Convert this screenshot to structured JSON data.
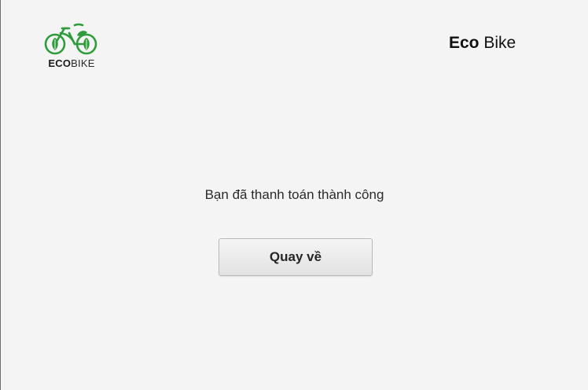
{
  "header": {
    "logo": {
      "icon": "bicycle-leaf-icon",
      "text_bold": "ECO",
      "text_regular": "BIKE",
      "color": "#2e9c3a"
    },
    "brand": {
      "bold": "Eco",
      "regular": " Bike"
    }
  },
  "main": {
    "message": "Bạn đã thanh toán thành công",
    "back_button_label": "Quay về"
  }
}
